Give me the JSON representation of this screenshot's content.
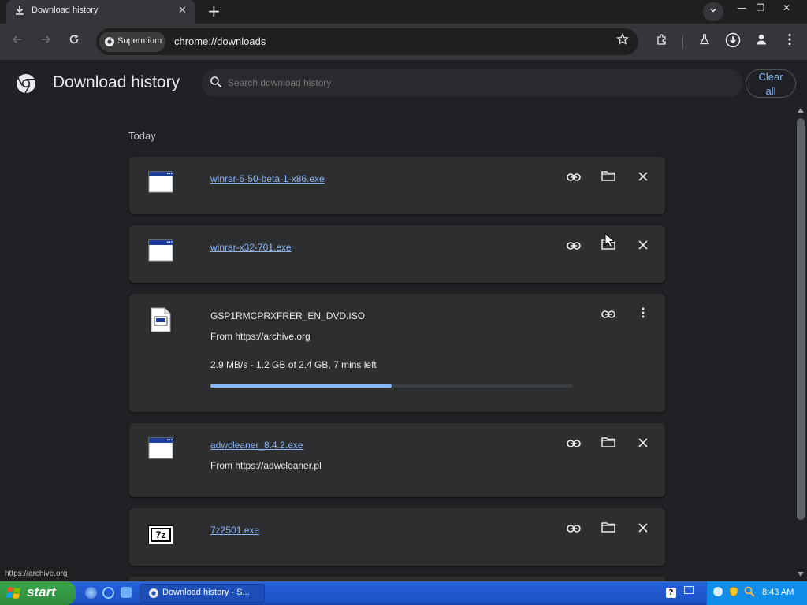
{
  "browser": {
    "tab_title": "Download history",
    "tab_close": "✕",
    "new_tab": "+",
    "window_controls": {
      "minimize": "—",
      "restore": "❐",
      "close": "✕"
    },
    "profile_chip": "Supermium",
    "url": "chrome://downloads",
    "status_url": "https://archive.org"
  },
  "page": {
    "title": "Download history",
    "search_placeholder": "Search download history",
    "clear_all": "Clear all",
    "section_label": "Today"
  },
  "downloads": [
    {
      "name": "winrar-5-50-beta-1-x86.exe",
      "icon": "window-app-icon",
      "linked": true
    },
    {
      "name": "winrar-x32-701.exe",
      "icon": "window-app-icon",
      "linked": true
    },
    {
      "name": "GSP1RMCPRXFRER_EN_DVD.ISO",
      "icon": "disc-image-file-icon",
      "linked": false,
      "from": "From https://archive.org",
      "status": "2.9 MB/s - 1.2 GB of 2.4 GB, 7 mins left",
      "progress": 0.5
    },
    {
      "name": "adwcleaner_8.4.2.exe",
      "icon": "window-app-icon",
      "linked": true,
      "from": "From https://adwcleaner.pl"
    },
    {
      "name": "7z2501.exe",
      "icon": "7zip-icon",
      "linked": true
    }
  ],
  "icons": {
    "seven_zip_text": "7z"
  },
  "taskbar": {
    "start": "start",
    "task_label": "Download history - S...",
    "clock": "8:43 AM"
  },
  "colors": {
    "accent": "#8ab4f8",
    "page_bg": "#202124",
    "card_bg": "#2d2e30"
  }
}
